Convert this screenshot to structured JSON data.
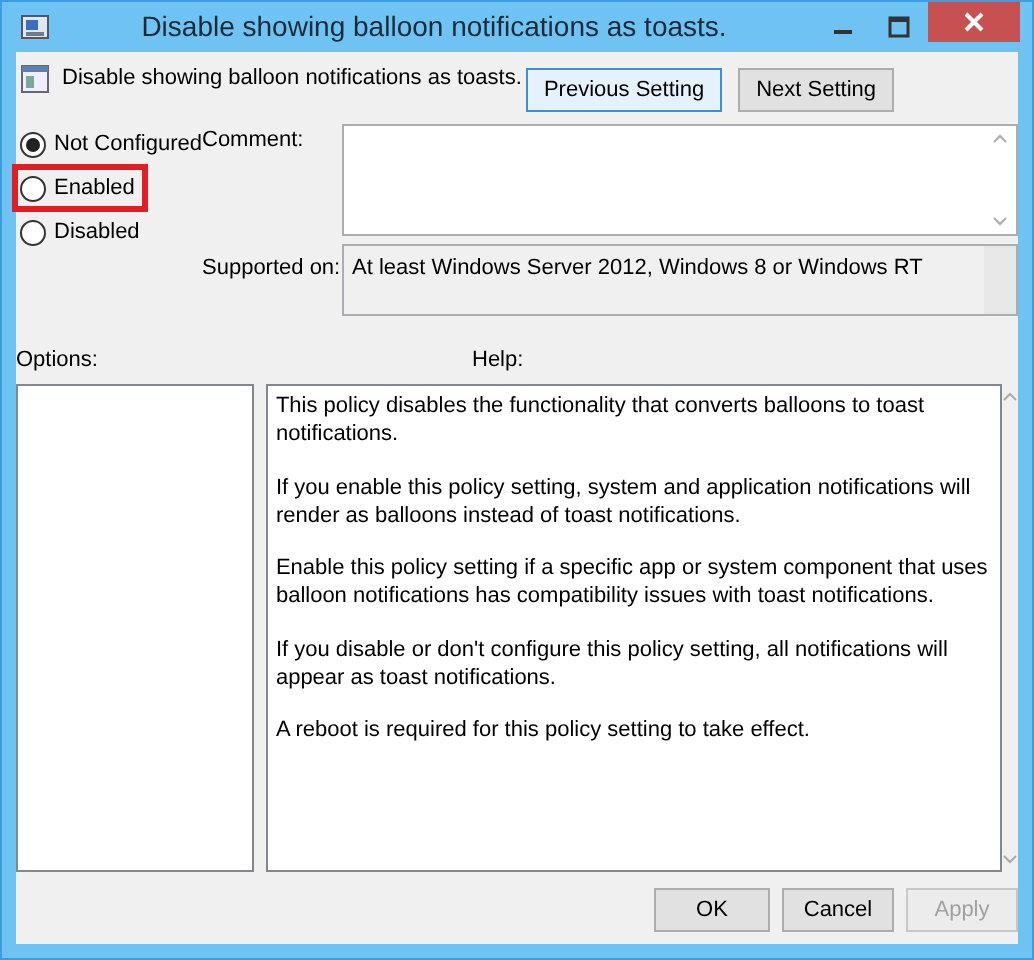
{
  "window": {
    "title": "Disable showing balloon notifications as toasts."
  },
  "header": {
    "title": "Disable showing balloon notifications as toasts."
  },
  "nav_buttons": [
    {
      "label": "Previous Setting",
      "default": true
    },
    {
      "label": "Next Setting",
      "default": false
    }
  ],
  "states": [
    {
      "label": "Not Configured",
      "selected": true,
      "highlighted": false
    },
    {
      "label": "Enabled",
      "selected": false,
      "highlighted": true
    },
    {
      "label": "Disabled",
      "selected": false,
      "highlighted": false
    }
  ],
  "comment": {
    "label": "Comment:"
  },
  "supported_on": {
    "label": "Supported on:",
    "value": "At least Windows Server 2012, Windows 8 or Windows RT"
  },
  "options": {
    "label": "Options:"
  },
  "help": {
    "label": "Help:",
    "paragraphs": [
      "This policy disables the functionality that converts balloons to toast notifications.",
      "If you enable this policy setting, system and application notifications will render as balloons instead of toast notifications.",
      "Enable this policy setting if a specific app or system component that uses balloon notifications has compatibility issues with toast notifications.",
      "If you disable or don't configure this policy setting, all notifications will appear as toast notifications.",
      "A reboot is required for this policy setting to take effect."
    ]
  },
  "buttons": [
    {
      "label": "OK",
      "disabled": false
    },
    {
      "label": "Cancel",
      "disabled": false
    },
    {
      "label": "Apply",
      "disabled": true
    }
  ]
}
